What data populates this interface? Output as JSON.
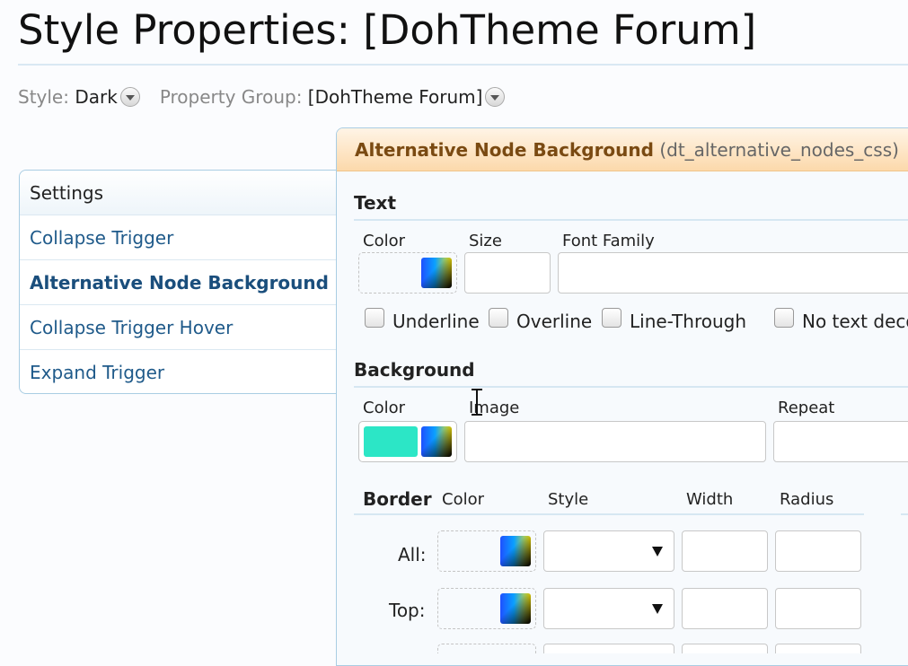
{
  "page": {
    "title": "Style Properties: [DohTheme Forum]"
  },
  "selectors": {
    "style_label": "Style:",
    "style_value": "Dark",
    "group_label": "Property Group:",
    "group_value": "[DohTheme Forum]"
  },
  "sidebar": {
    "header": "Settings",
    "items": [
      {
        "label": "Collapse Trigger",
        "active": false
      },
      {
        "label": "Alternative Node Background",
        "active": true
      },
      {
        "label": "Collapse Trigger Hover",
        "active": false
      },
      {
        "label": "Expand Trigger",
        "active": false
      }
    ]
  },
  "panel": {
    "title": "Alternative Node Background",
    "key": "(dt_alternative_nodes_css)",
    "text_section": {
      "title": "Text",
      "color_label": "Color",
      "size_label": "Size",
      "font_family_label": "Font Family",
      "checkboxes": [
        "Underline",
        "Overline",
        "Line-Through",
        "No text deco"
      ]
    },
    "background_section": {
      "title": "Background",
      "color_label": "Color",
      "image_label": "Image",
      "repeat_label": "Repeat",
      "swatch_color": "#2ce6c6"
    },
    "border_section": {
      "title": "Border",
      "col_color": "Color",
      "col_style": "Style",
      "col_width": "Width",
      "col_radius": "Radius",
      "rows": [
        {
          "label": "All:"
        },
        {
          "label": "Top:"
        }
      ]
    }
  }
}
